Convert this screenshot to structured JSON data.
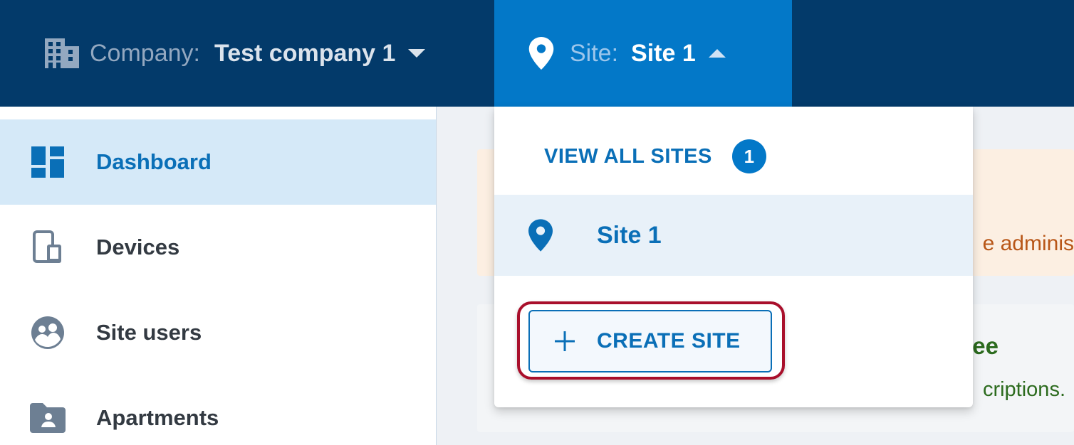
{
  "header": {
    "company": {
      "icon": "building-icon",
      "label": "Company:",
      "value": "Test company 1",
      "caret": "chevron-down-icon"
    },
    "site": {
      "icon": "location-pin-icon",
      "label": "Site:",
      "value": "Site 1",
      "caret": "chevron-up-icon"
    }
  },
  "sidebar": {
    "items": [
      {
        "icon": "dashboard-icon",
        "label": "Dashboard",
        "active": true
      },
      {
        "icon": "devices-icon",
        "label": "Devices"
      },
      {
        "icon": "users-icon",
        "label": "Site users"
      },
      {
        "icon": "apartments-icon",
        "label": "Apartments"
      }
    ]
  },
  "main": {
    "banner_text": "e adminis",
    "card": {
      "title_fragment": "ee",
      "text_fragment": "criptions."
    }
  },
  "dropdown": {
    "view_all_label": "VIEW ALL SITES",
    "count": "1",
    "sites": [
      {
        "icon": "location-pin-icon",
        "name": "Site 1"
      }
    ],
    "create_label": "CREATE SITE",
    "create_icon": "plus-icon"
  },
  "colors": {
    "topbar": "#033a6a",
    "site_tab": "#0378c8",
    "accent": "#0a6fb7",
    "highlight_outline": "#a90f2b"
  }
}
